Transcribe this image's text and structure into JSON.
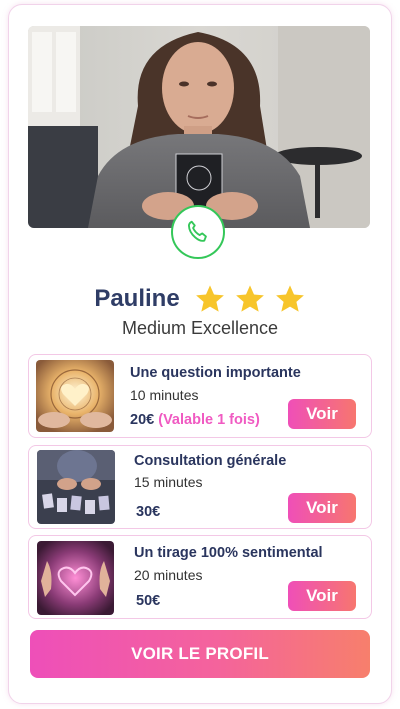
{
  "advisor": {
    "name": "Pauline",
    "rating_stars": 3,
    "title": "Medium Excellence"
  },
  "contact": {
    "icon": "phone-icon",
    "color": "#34c759"
  },
  "offers": [
    {
      "title": "Une question importante",
      "duration": "10 minutes",
      "price": "20€",
      "note": "(Valable 1 fois)",
      "button": "Voir"
    },
    {
      "title": "Consultation générale",
      "duration": "15 minutes",
      "price": "30€",
      "button": "Voir"
    },
    {
      "title": "Un tirage 100% sentimental",
      "duration": "20 minutes",
      "price": "50€",
      "button": "Voir"
    }
  ],
  "profile_button": "VOIR LE PROFIL",
  "colors": {
    "accent_pink": "#f05ac2",
    "gradient_start": "#ee4fb9",
    "gradient_end": "#f77f6c",
    "text_navy": "#2f3d66",
    "star": "#f7c52b"
  }
}
